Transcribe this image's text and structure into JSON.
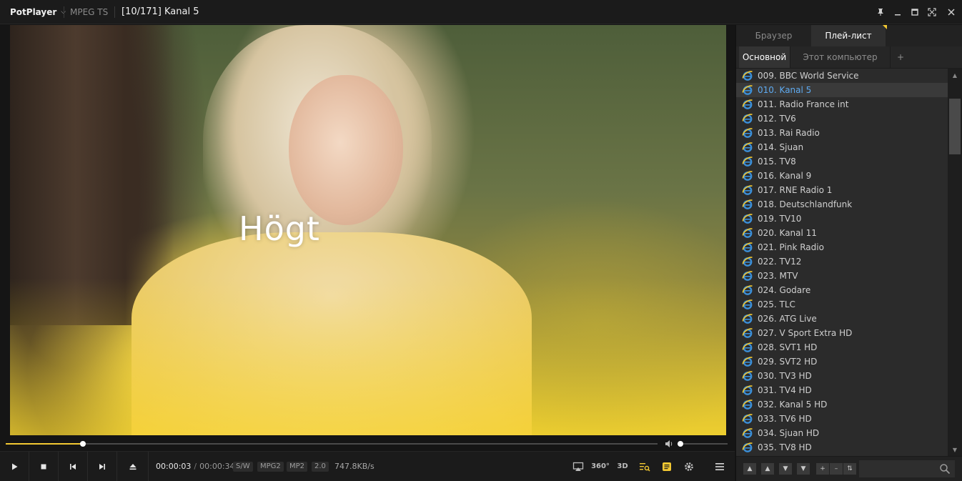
{
  "titlebar": {
    "app_name": "PotPlayer",
    "format": "MPEG TS",
    "title": "[10/171] Kanal 5"
  },
  "video": {
    "caption": "Högt"
  },
  "seek": {
    "progress": 0.118,
    "volume": 0.06
  },
  "controls": {
    "current_time": "00:00:03",
    "separator": "/",
    "total_time": "00:00:34",
    "badges": [
      "S/W",
      "MPG2",
      "MP2",
      "2.0"
    ],
    "bitrate": "747.8KB/s",
    "label_360": "360°",
    "label_3d": "3D"
  },
  "panel": {
    "tabs": [
      "Браузер",
      "Плей-лист"
    ],
    "active_tab": 1,
    "subtabs": [
      "Основной",
      "Этот компьютер",
      "+"
    ],
    "items": [
      "009. BBC World Service",
      "010. Kanal 5",
      "011. Radio France int",
      "012. TV6",
      "013. Rai Radio",
      "014. Sjuan",
      "015. TV8",
      "016. Kanal 9",
      "017. RNE Radio 1",
      "018. Deutschlandfunk",
      "019. TV10",
      "020. Kanal 11",
      "021. Pink Radio",
      "022. TV12",
      "023. MTV",
      "024. Godare",
      "025. TLC",
      "026. ATG Live",
      "027. V Sport Extra HD",
      "028. SVT1 HD",
      "029. SVT2 HD",
      "030. TV3 HD",
      "031. TV4 HD",
      "032. Kanal 5 HD",
      "033. TV6 HD",
      "034. Sjuan HD",
      "035. TV8 HD"
    ],
    "current_index": 1
  },
  "colors": {
    "accent": "#f2c832",
    "current_item": "#5eaaf0"
  }
}
